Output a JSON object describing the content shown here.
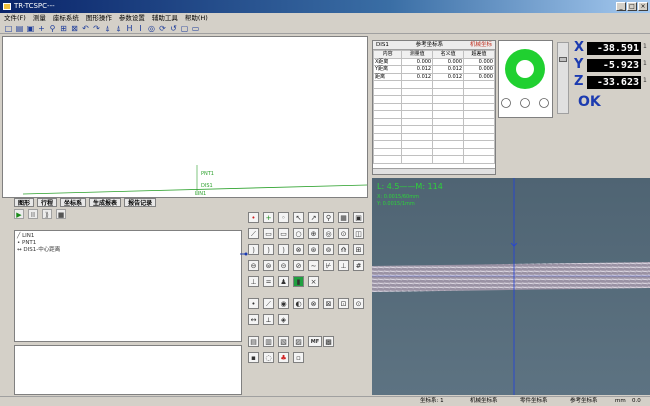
{
  "window": {
    "title": "TR-TCSPC---"
  },
  "menu": [
    "文件(F)",
    "测量",
    "座标系统",
    "图形操作",
    "参数设置",
    "辅助工具",
    "帮助(H)"
  ],
  "toolbar": {
    "icons": [
      "new-icon",
      "open-icon",
      "save-icon",
      "cross-icon",
      "zoom-icon",
      "fit-icon",
      "select-icon",
      "undo-icon",
      "redo-icon",
      "measure-icon",
      "probe-icon",
      "height-icon",
      "i-icon",
      "circle-icon",
      "refresh-icon",
      "arc-icon",
      "box-icon",
      "window-icon"
    ],
    "glyphs": [
      "□",
      "▤",
      "▣",
      "+",
      "⚲",
      "⊞",
      "⊠",
      "↶",
      "↷",
      "⍋",
      "⍋",
      "H",
      "I",
      "◎",
      "⟳",
      "↺",
      "▢",
      "▭"
    ]
  },
  "cad": {
    "labels": [
      "PNT1",
      "DIS1",
      "LIN1"
    ],
    "colors": {
      "line": "#2aa02a"
    }
  },
  "tabs": [
    "图形",
    "行程",
    "坐标系",
    "生成报表",
    "报告记录"
  ],
  "smallbar": {
    "buttons": [
      "▶",
      "II",
      "⟫",
      "■"
    ],
    "names": [
      "play-icon",
      "pause-icon",
      "step-icon",
      "stop-icon"
    ]
  },
  "tree": {
    "items": [
      "LIN1",
      "PNT1",
      "DIS1-中心距离"
    ]
  },
  "measure_table": {
    "title": "DIS1",
    "header_mid": "参考坐标系",
    "header_right": "机械坐标",
    "columns": [
      "内容",
      "测量值",
      "名义值",
      "超差值"
    ],
    "rows": [
      [
        "X距离",
        "0.000",
        "0.000",
        "0.000"
      ],
      [
        "Y距离",
        "0.012",
        "0.012",
        "0.000"
      ],
      [
        "距离",
        "0.012",
        "0.012",
        "0.000"
      ]
    ]
  },
  "coords": {
    "x": {
      "label": "X",
      "value": "-38.591"
    },
    "y": {
      "label": "Y",
      "value": "-5.923"
    },
    "z": {
      "label": "Z",
      "value": "-33.623"
    },
    "unit": "1"
  },
  "status_ok": "OK",
  "camera": {
    "label": "L: 4.5——M: 114",
    "sub1": "X: 0.0015/60mm",
    "sub2": "Y: 0.0015/1mm"
  },
  "statusbar": {
    "items": [
      "坐标系: 1",
      "机械坐标系",
      "零件坐标系",
      "参考坐标系",
      "mm",
      "0.0"
    ]
  },
  "tools": {
    "row1": [
      "•",
      "+",
      "◦",
      "↖",
      "↗",
      "⚲",
      "▦",
      "▣"
    ],
    "row2": [
      "⟋",
      "▭",
      "▭",
      "○",
      "⊕",
      "◎",
      "⊙",
      "◫"
    ],
    "row3": [
      "⟯",
      "⟯",
      "⟯",
      "⊗",
      "⊛",
      "⊚",
      "⟰",
      "⊞"
    ],
    "row4": [
      "⊖",
      "⊜",
      "⊝",
      "⊘",
      "∼",
      "⊬",
      "⊥",
      "#"
    ],
    "row5": [
      "⊥",
      "=",
      "♟",
      "▮",
      "×"
    ],
    "row6": [
      "•",
      "⟋",
      "◉",
      "◐",
      "⊗",
      "⊠",
      "⊡",
      "⊙"
    ],
    "row7": [
      "↔",
      "⟂",
      "◈"
    ],
    "row8": [
      "▤",
      "▥",
      "▧",
      "▨",
      "MF",
      "▩"
    ],
    "row9": [
      "▪",
      "◌",
      "♣",
      "▫"
    ]
  }
}
